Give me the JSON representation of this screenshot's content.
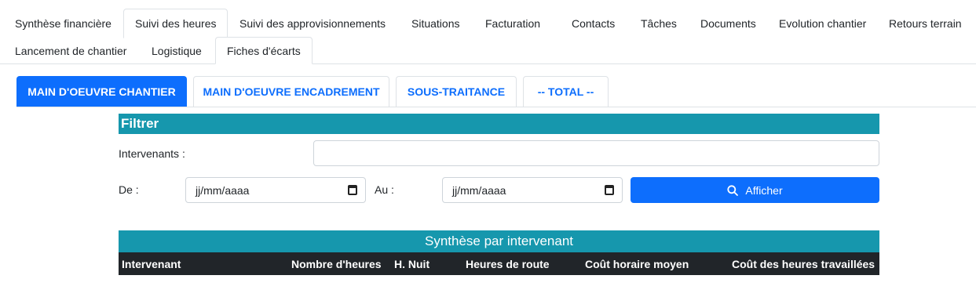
{
  "top_tabs": {
    "row1": [
      {
        "label": "Synthèse financière"
      },
      {
        "label": "Suivi des heures"
      },
      {
        "label": "Suivi des approvisionnements"
      },
      {
        "label": "Situations"
      },
      {
        "label": "Facturation"
      },
      {
        "label": "Contacts"
      },
      {
        "label": "Tâches"
      },
      {
        "label": "Documents"
      },
      {
        "label": "Evolution chantier"
      },
      {
        "label": "Retours terrain"
      }
    ],
    "row2": [
      {
        "label": "Lancement de chantier"
      },
      {
        "label": "Logistique"
      },
      {
        "label": "Fiches d'écarts"
      }
    ],
    "active": "Suivi des heures"
  },
  "sub_tabs": [
    {
      "label": "MAIN D'OEUVRE CHANTIER"
    },
    {
      "label": "MAIN D'OEUVRE ENCADREMENT"
    },
    {
      "label": "SOUS-TRAITANCE"
    },
    {
      "label": "-- TOTAL --"
    }
  ],
  "filter": {
    "title": "Filtrer",
    "intervenants_label": "Intervenants :",
    "intervenants_value": "",
    "from_label": "De :",
    "from_placeholder": "jj/mm/aaaa",
    "to_label": "Au :",
    "to_placeholder": "jj/mm/aaaa",
    "button_label": "Afficher",
    "button_icon": "search-icon"
  },
  "synthese": {
    "title": "Synthèse par intervenant",
    "columns": [
      "Intervenant",
      "Nombre d'heures",
      "H. Nuit",
      "Heures de route",
      "Coût horaire moyen",
      "Coût des heures travaillées"
    ],
    "rows": []
  },
  "colors": {
    "primary": "#0d6efd",
    "teal": "#1697ad",
    "dark": "#212529"
  }
}
